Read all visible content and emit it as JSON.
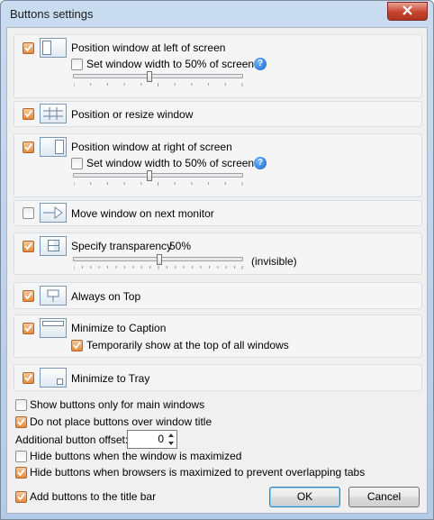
{
  "window": {
    "title": "Buttons settings"
  },
  "groups": {
    "left": {
      "checked": true,
      "label": "Position window at left of screen",
      "sub_checkbox_label": "Set window width to 50% of screen",
      "sub_checked": false,
      "slider_value": 0.5
    },
    "resize": {
      "checked": true,
      "label": "Position or resize window"
    },
    "right": {
      "checked": true,
      "label": "Position window at right of screen",
      "sub_checkbox_label": "Set window width to 50% of screen",
      "sub_checked": false,
      "slider_value": 0.5
    },
    "monitor": {
      "checked": false,
      "label": "Move window on next monitor"
    },
    "transparency": {
      "checked": true,
      "label": "Specify transparency",
      "value_text": "50%",
      "end_label": "(invisible)",
      "slider_value": 0.5
    },
    "ontop": {
      "checked": true,
      "label": "Always on Top"
    },
    "caption": {
      "checked": true,
      "label": "Minimize to Caption",
      "sub_checkbox_label": "Temporarily show at the top of all windows",
      "sub_checked": true
    },
    "tray": {
      "checked": true,
      "label": "Minimize to Tray"
    }
  },
  "options": {
    "main_windows_only": {
      "checked": false,
      "label": "Show buttons only for main windows"
    },
    "no_over_title": {
      "checked": true,
      "label": "Do not place buttons over window title"
    },
    "offset": {
      "label": "Additional button offset:",
      "value": "0"
    },
    "hide_maximized": {
      "checked": false,
      "label": "Hide buttons when the window is maximized"
    },
    "hide_browsers": {
      "checked": true,
      "label": "Hide buttons when browsers is maximized to prevent overlapping tabs"
    },
    "add_to_titlebar": {
      "checked": true,
      "label": "Add buttons to the title bar"
    }
  },
  "buttons": {
    "ok": "OK",
    "cancel": "Cancel"
  },
  "icons": {
    "help": "help-icon",
    "close": "close-icon"
  },
  "colors": {
    "checkbox_checked": "#e48a3c",
    "help": "#1766c8",
    "close": "#c6442e"
  }
}
